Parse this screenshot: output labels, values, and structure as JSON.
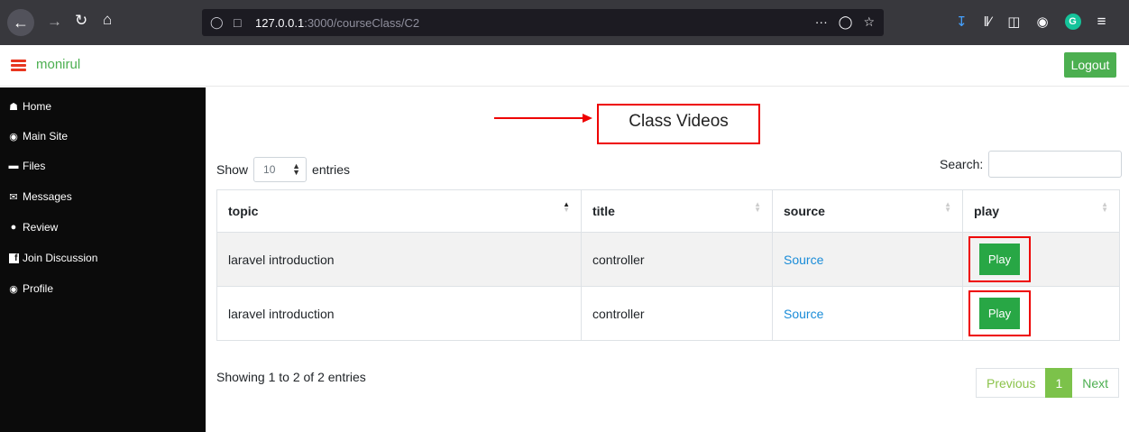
{
  "browser": {
    "url_host": "127.0.0.1",
    "url_rest": ":3000/courseClass/C2",
    "more_label": "···"
  },
  "appbar": {
    "username": "monirul",
    "logout_label": "Logout",
    "accent_color": "#4caf50",
    "menu_color": "#e8361f"
  },
  "sidebar": {
    "items": [
      {
        "label": "Home",
        "icon": "home-icon"
      },
      {
        "label": "Main Site",
        "icon": "globe-icon"
      },
      {
        "label": "Files",
        "icon": "folder-icon"
      },
      {
        "label": "Messages",
        "icon": "envelope-icon"
      },
      {
        "label": "Review",
        "icon": "comments-icon"
      },
      {
        "label": "Join Discussion",
        "icon": "facebook-icon"
      },
      {
        "label": "Profile",
        "icon": "user-circle-icon"
      }
    ]
  },
  "main": {
    "title": "Class Videos",
    "show_label": "Show",
    "entries_value": "10",
    "entries_label": "entries",
    "search_label": "Search:",
    "search_value": "",
    "columns": [
      "topic",
      "title",
      "source",
      "play"
    ],
    "rows": [
      {
        "topic": "laravel introduction",
        "title": "controller",
        "source": "Source",
        "play": "Play"
      },
      {
        "topic": "laravel introduction",
        "title": "controller",
        "source": "Source",
        "play": "Play"
      }
    ],
    "info": "Showing 1 to 2 of 2 entries",
    "pager": {
      "previous": "Previous",
      "current": "1",
      "next": "Next"
    }
  }
}
